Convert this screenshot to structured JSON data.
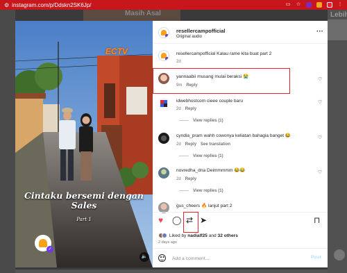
{
  "browser": {
    "url": "instagram.com/p/Ddskn2SK6Jp/"
  },
  "background": {
    "banner_text": "Masih Asal",
    "right_text": "Lebih Dinger?"
  },
  "media": {
    "logo_text": "ECTV",
    "caption_title": "Cintaku bersemi dengan Sales",
    "caption_part": "Part 1"
  },
  "post": {
    "username": "resellercampofficial",
    "audio": "Original audio",
    "caption": {
      "username": "resellercampofficial",
      "text": "Kalau rame kita buat part 2",
      "time": "2d"
    },
    "comments": [
      {
        "username": "yannaabii",
        "text": "musang mulai beraksi 😭",
        "time": "9m",
        "reply": "Reply",
        "translate": "",
        "view_replies": ""
      },
      {
        "username": "idwebhostcom",
        "text": "cieee couple baru",
        "time": "2d",
        "reply": "Reply",
        "translate": "",
        "view_replies": "View replies (1)"
      },
      {
        "username": "cyndia_pram",
        "text": "wahh cowonya keliatan bahagia banget 😂",
        "time": "2d",
        "reply": "Reply",
        "translate": "See translation",
        "view_replies": "View replies (1)"
      },
      {
        "username": "novredha_dna",
        "text": "Deimmmmm 😂😂",
        "time": "2d",
        "reply": "Reply",
        "translate": "",
        "view_replies": "View replies (1)"
      },
      {
        "username": "gus_cheers",
        "text": "🔥 lanjut part 2",
        "time": "",
        "reply": "",
        "translate": "",
        "view_replies": ""
      }
    ],
    "likes": {
      "prefix": "Liked by",
      "user": "nadialf25",
      "and": "and",
      "others": "32 others"
    },
    "time_ago": "2 days ago",
    "comment_input": {
      "placeholder": "Add a comment..."
    },
    "post_button": "Post"
  },
  "icons": {
    "heart": "heart-filled-icon",
    "comment": "comment-icon",
    "share": "repost-icon",
    "send": "send-icon",
    "save": "bookmark-icon",
    "more": "more-horizontal-icon",
    "emoji": "emoji-icon",
    "mute": "mute-icon"
  },
  "colors": {
    "like_red": "#ed4956",
    "highlight_red": "#e4222a",
    "browser_red": "#c8161d",
    "post_button": "#b2dffc"
  }
}
